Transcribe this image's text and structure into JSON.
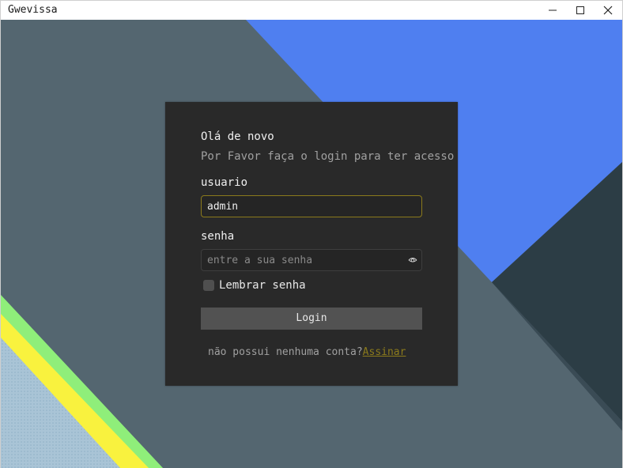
{
  "window": {
    "title": "Gwevissa",
    "controls": {
      "minimize_icon": "minimize-icon",
      "maximize_icon": "maximize-icon",
      "close_icon": "close-icon"
    }
  },
  "login": {
    "greeting": "Olá de novo",
    "subtitle": "Por Favor faça o login para ter acesso",
    "username": {
      "label": "usuario",
      "value": "admin"
    },
    "password": {
      "label": "senha",
      "placeholder": "entre a sua senha",
      "toggle_icon": "eye-icon"
    },
    "remember": {
      "label": "Lembrar senha",
      "checked": false
    },
    "submit_label": "Login",
    "signup": {
      "text": "não possui nenhuma conta?",
      "link": "Assinar"
    }
  },
  "colors": {
    "card_background": "#292929",
    "accent": "#8c7b1c",
    "button": "#525252",
    "background_slate": "#546670",
    "background_blue": "#4f7ff0",
    "background_dark": "#2c3d45",
    "stripe_green": "#8fee7a",
    "stripe_yellow": "#f9f23e"
  }
}
